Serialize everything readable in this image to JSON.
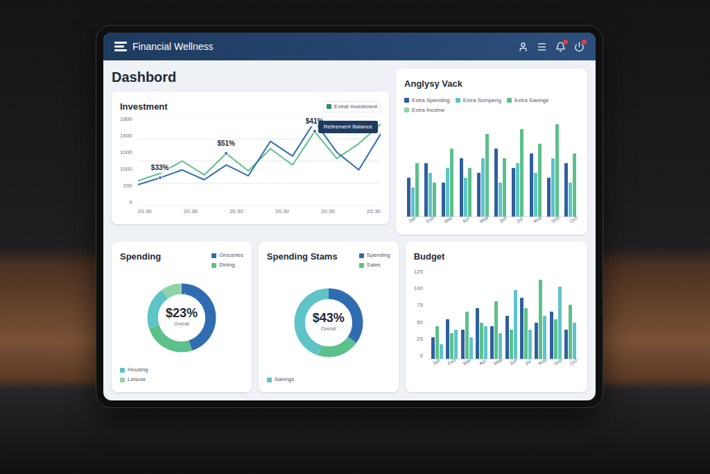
{
  "header": {
    "title": "Financial Wellness",
    "icons": [
      {
        "name": "user",
        "badge": false
      },
      {
        "name": "menu",
        "badge": false
      },
      {
        "name": "bell",
        "badge": true
      },
      {
        "name": "power",
        "badge": true
      }
    ]
  },
  "page_title": "Dashbord",
  "investment": {
    "title": "Investment",
    "legend": [
      {
        "label": "Extrat Investment",
        "color": "#2f8f6b"
      }
    ],
    "tooltip": "Retirement Balance",
    "y_ticks": [
      "1800",
      "1600",
      "1000",
      "1000",
      "200",
      "0"
    ],
    "x_ticks": [
      "20.30",
      "20.36",
      "20.30",
      "20.30",
      "20.30",
      "20.30"
    ],
    "max": 1800,
    "series": [
      {
        "name": "Growth",
        "color": "#5cc08a",
        "values": [
          500,
          650,
          900,
          620,
          1050,
          700,
          1150,
          820,
          1500,
          950,
          1250,
          1650
        ]
      },
      {
        "name": "Balance",
        "color": "#2f6db0",
        "values": [
          420,
          560,
          720,
          520,
          820,
          600,
          1300,
          1000,
          1700,
          1080,
          720,
          1450
        ]
      }
    ],
    "annotations": [
      {
        "text": "$33%",
        "series": 1,
        "index": 1
      },
      {
        "text": "$51%",
        "series": 0,
        "index": 4
      },
      {
        "text": "$41%",
        "series": 0,
        "index": 8
      }
    ]
  },
  "analysis": {
    "title": "Anglysy Vack",
    "legend": [
      {
        "label": "Extra Spending",
        "color": "#2f5f9e"
      },
      {
        "label": "Extra Sompeng",
        "color": "#5fc4c8"
      },
      {
        "label": "Extra Savings",
        "color": "#5cc08a"
      },
      {
        "label": "Extra Income",
        "color": "#8fd4a8"
      }
    ],
    "max": 100,
    "x_labels": [
      "Jan",
      "Feb",
      "Mar",
      "Apr",
      "May",
      "Jun",
      "Jul",
      "Aug",
      "Sep",
      "Oct"
    ],
    "series": [
      {
        "color": "#2f5f9e",
        "values": [
          40,
          55,
          35,
          60,
          45,
          70,
          50,
          65,
          40,
          55
        ]
      },
      {
        "color": "#5fc4c8",
        "values": [
          30,
          45,
          50,
          40,
          60,
          35,
          55,
          45,
          60,
          35
        ]
      },
      {
        "color": "#5cc08a",
        "values": [
          55,
          35,
          70,
          50,
          85,
          60,
          90,
          75,
          95,
          65
        ]
      }
    ]
  },
  "spending": {
    "title": "Spending",
    "value": "$23%",
    "sublabel": "Overall",
    "segments": [
      {
        "label": "Groceries",
        "value": 45,
        "color": "#2f6db0"
      },
      {
        "label": "Dining",
        "value": 25,
        "color": "#5cc08a"
      },
      {
        "label": "Housing",
        "value": 20,
        "color": "#5fc4c8"
      },
      {
        "label": "Leisure",
        "value": 10,
        "color": "#8fd4a8"
      }
    ]
  },
  "spending_stats": {
    "title": "Spending Stams",
    "value": "$43%",
    "sublabel": "Overall",
    "segments": [
      {
        "label": "Spending",
        "value": 35,
        "color": "#2f6db0"
      },
      {
        "label": "Sales",
        "value": 20,
        "color": "#5cc08a"
      },
      {
        "label": "Savings",
        "value": 45,
        "color": "#5fc4c8"
      }
    ]
  },
  "budget": {
    "title": "Budget",
    "y_ticks": [
      "125",
      "100",
      "75",
      "50",
      "25",
      "0"
    ],
    "max": 125,
    "x_labels": [
      "Jan",
      "Feb",
      "Mar",
      "Apr",
      "May",
      "Jun",
      "Jul",
      "Aug",
      "Sep",
      "Oct"
    ],
    "series": [
      {
        "color": "#2f5f9e",
        "values": [
          30,
          55,
          40,
          70,
          45,
          60,
          85,
          50,
          65,
          40
        ]
      },
      {
        "color": "#5cc08a",
        "values": [
          45,
          35,
          65,
          50,
          80,
          40,
          70,
          110,
          55,
          75
        ]
      },
      {
        "color": "#5fc4c8",
        "values": [
          20,
          40,
          30,
          45,
          35,
          95,
          40,
          60,
          100,
          50
        ]
      }
    ]
  }
}
